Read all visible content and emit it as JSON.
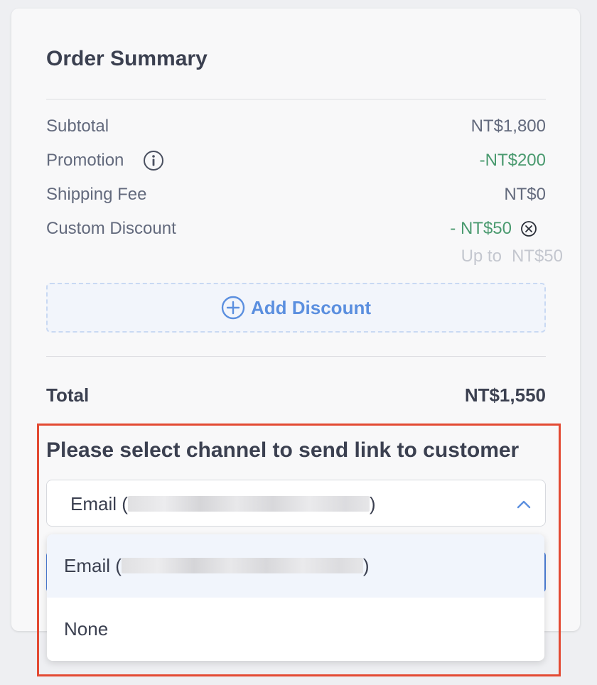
{
  "order_summary": {
    "title": "Order Summary",
    "subtotal_label": "Subtotal",
    "subtotal_value": "NT$1,800",
    "promotion_label": "Promotion",
    "promotion_value": "-NT$200",
    "shipping_label": "Shipping Fee",
    "shipping_value": "NT$0",
    "custom_discount_label": "Custom Discount",
    "custom_discount_value": "- NT$50",
    "upto_label": "Up to",
    "upto_value": "NT$50",
    "add_discount_label": "Add Discount",
    "total_label": "Total",
    "total_value": "NT$1,550"
  },
  "channel": {
    "label": "Please select channel to send link to customer",
    "selected_prefix": "Email (",
    "selected_suffix": ")",
    "options": [
      {
        "prefix": "Email (",
        "suffix": ")",
        "selected": true
      },
      {
        "label": "None",
        "selected": false
      }
    ]
  },
  "icons": {
    "promotion_info": "info-icon",
    "remove_discount": "close-circle-icon",
    "add_discount": "plus-circle-icon",
    "select_toggle": "chevron-up-icon"
  },
  "colors": {
    "discount_green": "#4a9a6f",
    "link_blue": "#5b8fdf",
    "highlight_red": "#e34a33"
  }
}
